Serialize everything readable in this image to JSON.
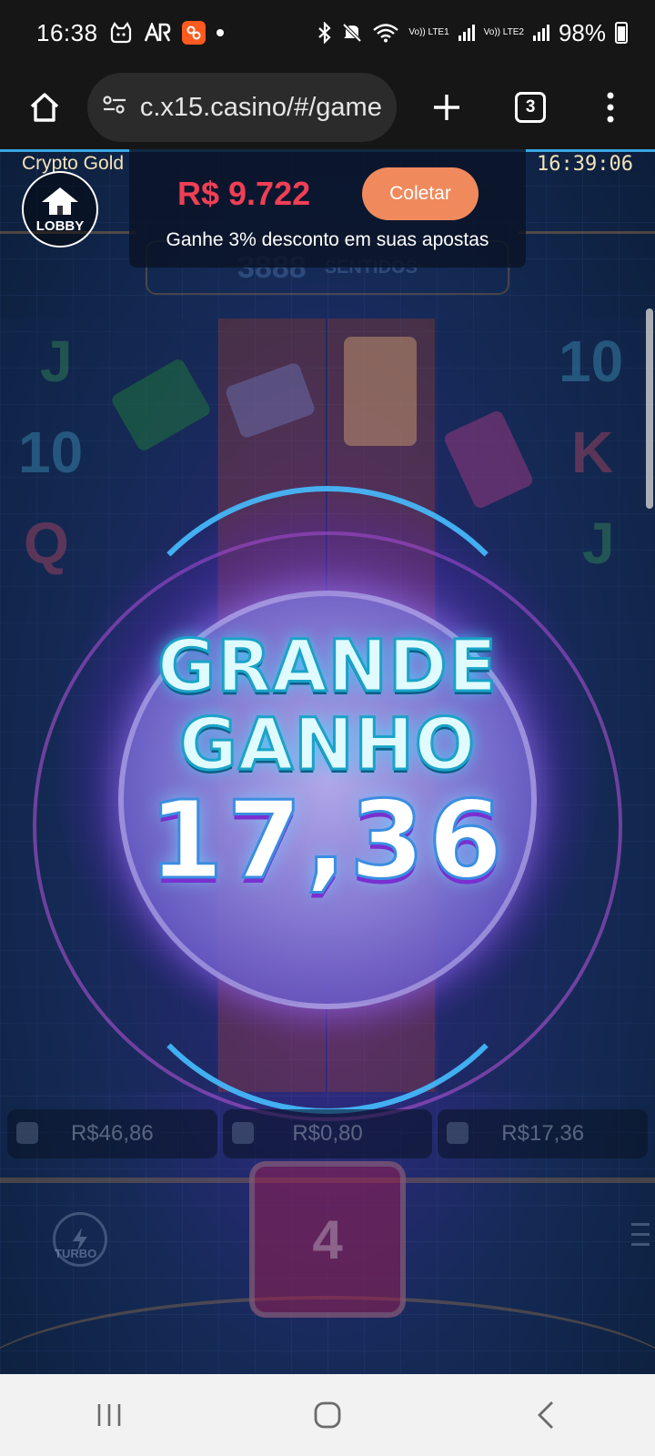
{
  "status_bar": {
    "time": "16:38",
    "net1_label": "Vo)) LTE1",
    "net2_label": "Vo)) LTE2",
    "battery": "98%",
    "icons": [
      "cat-icon",
      "ar-icon",
      "app-badge-icon",
      "notification-dot-icon",
      "bluetooth-icon",
      "mute-icon",
      "wifi-icon",
      "signal-icon",
      "battery-charging-icon"
    ]
  },
  "browser": {
    "url": "c.x15.casino/#/game",
    "tabs_count": "3",
    "icons": [
      "home-icon",
      "site-settings-icon",
      "plus-icon",
      "tabs-icon",
      "kebab-menu-icon"
    ]
  },
  "game": {
    "title": "Crypto Gold",
    "clock": "16:39:06",
    "lobby_label": "LOBBY",
    "balance": "R$ 9.722",
    "collect_label": "Coletar",
    "promo_text": "Ganhe 3% desconto em suas apostas",
    "ways_number": "3888",
    "ways_label": "SENTIDOS",
    "big_win_line1": "GRANDE",
    "big_win_line2": "GANHO",
    "big_win_amount": "17,36",
    "stats": {
      "balance": "R$46,86",
      "bet": "R$0,80",
      "win": "R$17,36"
    },
    "spin_label": "4",
    "turbo_label": "TURBO",
    "reel_symbols": {
      "left_top": "J",
      "left_mid": "10",
      "left_low": "Q",
      "right_top": "10",
      "right_mid": "K",
      "right_low": "J"
    },
    "colors": {
      "balance": "#ef3f55",
      "collect_button": "#f08a5d",
      "win_text": "#dffbff",
      "win_outline": "#1aa3c8"
    }
  },
  "nav_bar": {
    "icons": [
      "recent-apps-icon",
      "home-circle-icon",
      "back-icon"
    ]
  }
}
